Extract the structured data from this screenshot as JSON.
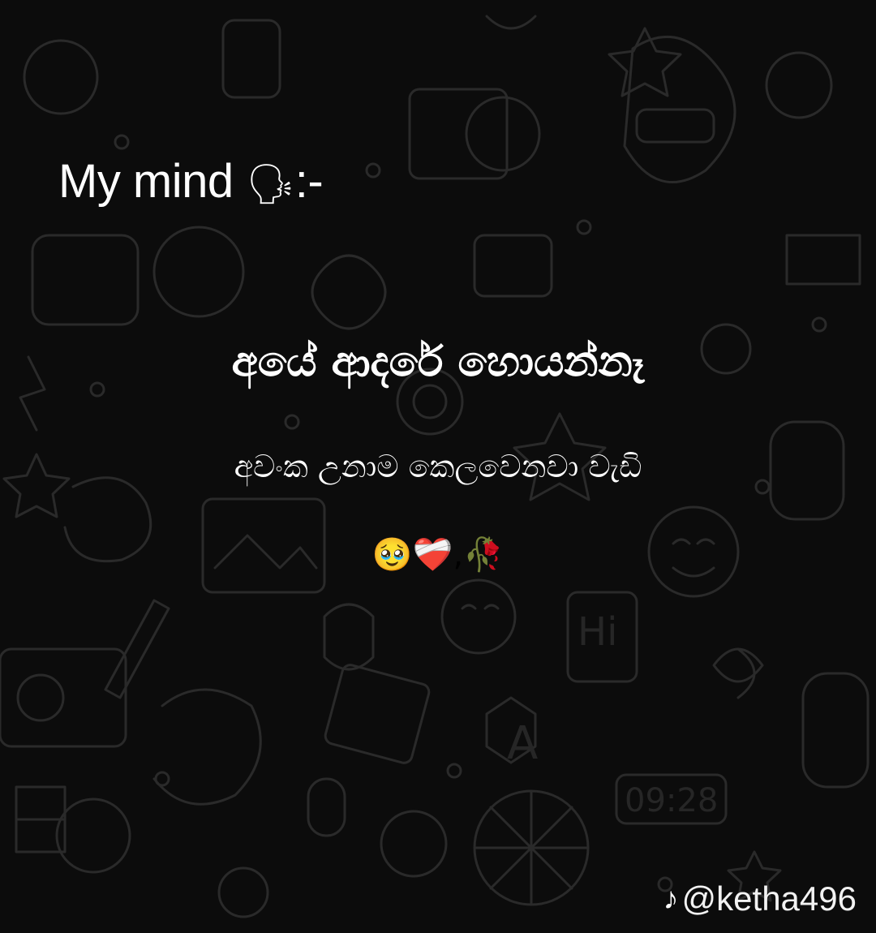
{
  "post": {
    "heading_text": "My mind",
    "heading_emoji": "🗣",
    "heading_suffix": ":-",
    "line_main": "අයේ ආදරේ හොයන්නෑ",
    "line_sub": "අවංක උනාම කෙලවෙනවා වැඩි",
    "emojis": "🥹❤️‍🩹,🥀"
  },
  "watermark": {
    "icon": "tiktok-icon",
    "icon_glyph": "♪",
    "handle": "@ketha496"
  },
  "colors": {
    "background": "#0c0c0c",
    "doodle_stroke": "#2a2a2a",
    "text": "#ffffff"
  }
}
